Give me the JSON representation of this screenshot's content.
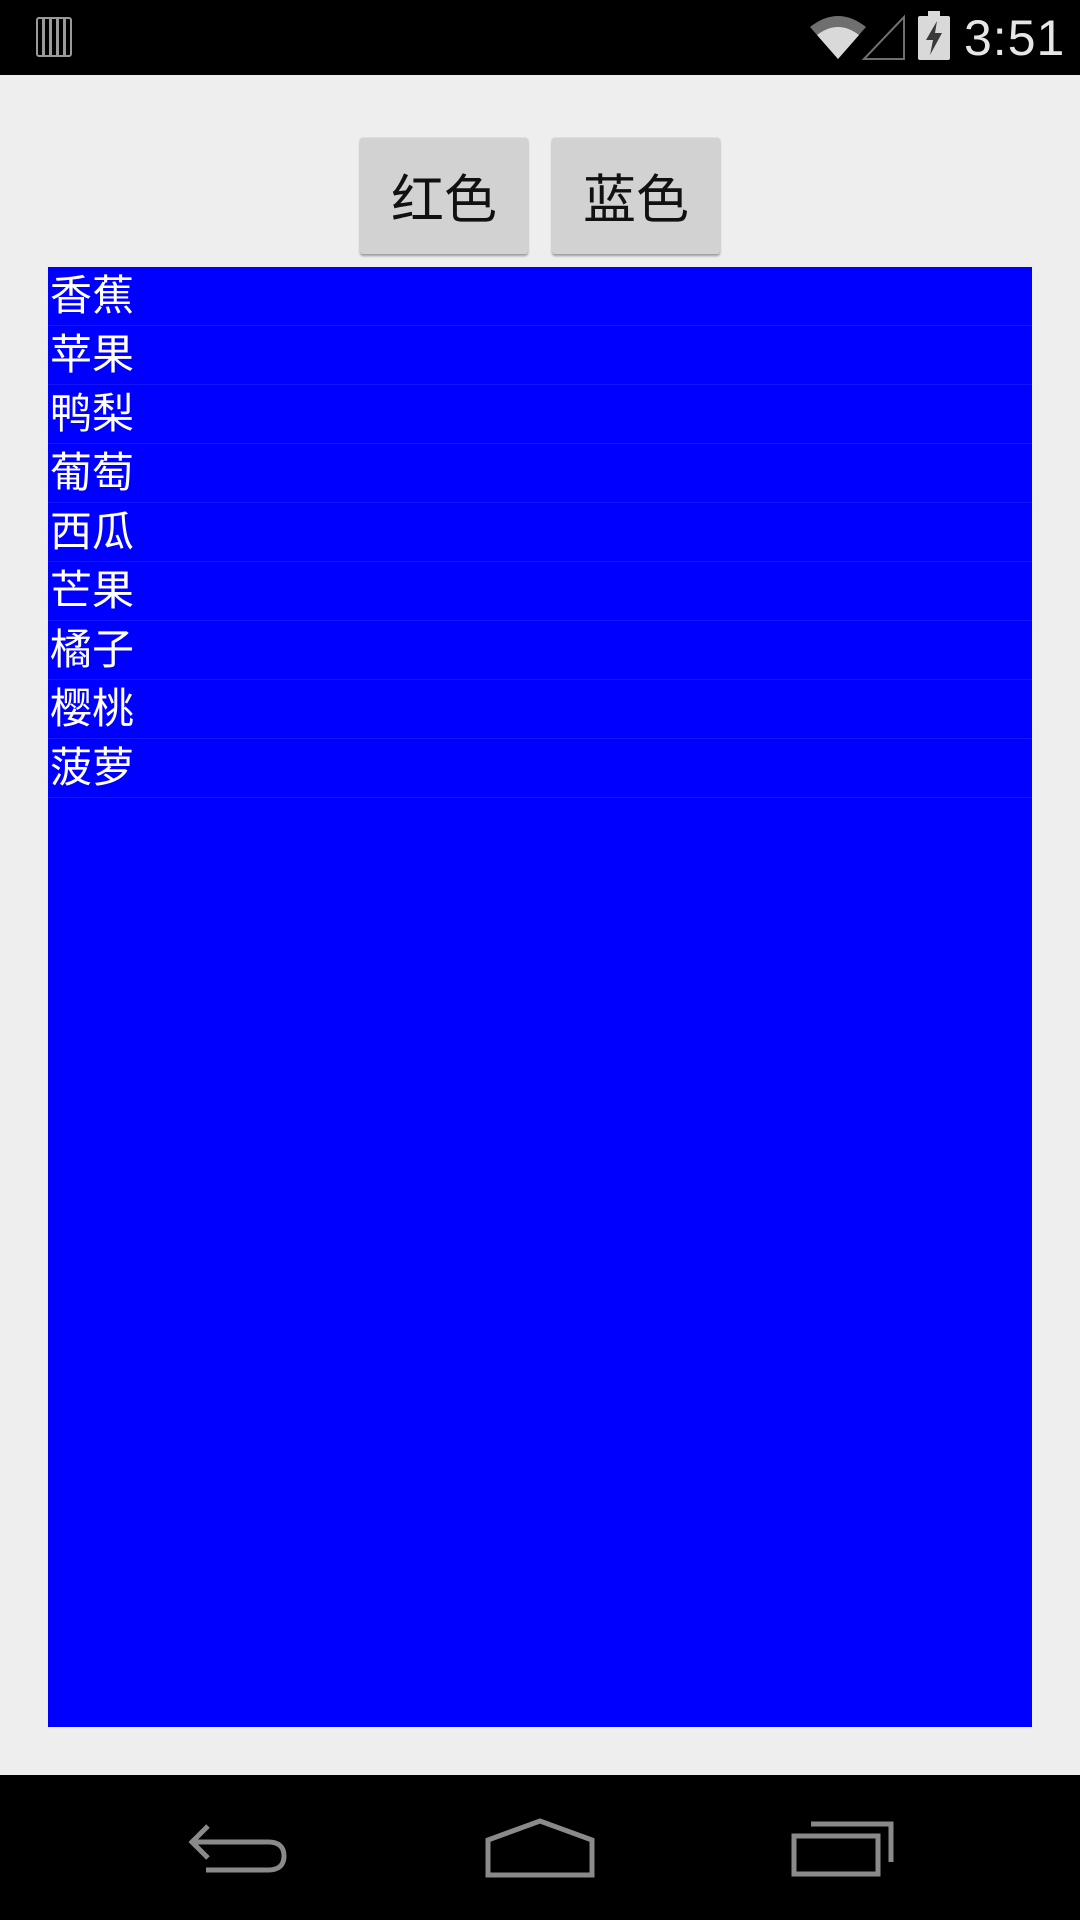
{
  "status_bar": {
    "time": "3:51",
    "icons": [
      "notification-icon",
      "wifi-icon",
      "signal-icon",
      "battery-charging-icon"
    ]
  },
  "buttons": {
    "red_label": "红色",
    "blue_label": "蓝色"
  },
  "list": {
    "background_color": "#0000ff",
    "text_color": "#ffffff",
    "items": [
      "香蕉",
      "苹果",
      "鸭梨",
      "葡萄",
      "西瓜",
      "芒果",
      "橘子",
      "樱桃",
      "菠萝"
    ]
  },
  "nav_bar": {
    "icons": [
      "back-icon",
      "home-icon",
      "recents-icon"
    ]
  }
}
